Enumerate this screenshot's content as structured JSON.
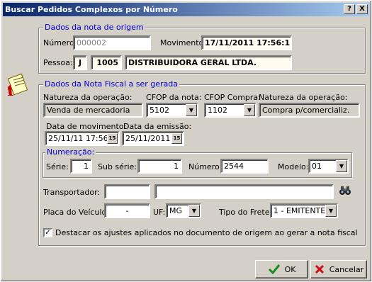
{
  "window": {
    "title": "Buscar Pedidos Complexos por Número",
    "help_label": "?",
    "close_label": "X"
  },
  "origem": {
    "legend": "Dados da nota de origem",
    "numero_label": "Número:",
    "numero_value": "000002",
    "movimento_label": "Movimento:",
    "movimento_value": "17/11/2011 17:56:12",
    "pessoa_label": "Pessoa:",
    "pessoa_tipo": "J",
    "pessoa_codigo": "1005",
    "pessoa_nome": "DISTRIBUIDORA GERAL LTDA."
  },
  "nota": {
    "legend": "Dados da Nota Fiscal a ser gerada",
    "natureza_label": "Natureza da operação:",
    "natureza_value": "Venda de mercadoria",
    "cfop_nota_label": "CFOP da nota:",
    "cfop_nota_value": "5102",
    "cfop_compra_label": "CFOP Compra:",
    "cfop_compra_value": "1102",
    "natureza2_label": "Natureza da operação:",
    "natureza2_value": "Compra p/comercializ.",
    "data_mov_label": "Data de movimento:",
    "data_mov_value": "25/11/11 17:56",
    "data_emis_label": "Data da emissão:",
    "data_emis_value": "25/11/2011",
    "cal_label": "15",
    "numeracao_legend": "Numeração:",
    "serie_label": "Série:",
    "serie_value": "1",
    "subserie_label": "Sub série:",
    "subserie_value": "1",
    "numero_label": "Número:",
    "numero_value": "2544",
    "modelo_label": "Modelo:",
    "modelo_value": "01",
    "transportador_label": "Transportador:",
    "transportador_codigo": "",
    "transportador_nome": "",
    "placa_label": "Placa do Veículo:",
    "placa_value": "-",
    "uf_label": "UF:",
    "uf_value": "MG",
    "frete_label": "Tipo do Frete:",
    "frete_value": "1 - EMITENTE",
    "destacar_label": "Destacar os ajustes aplicados no documento de origem ao gerar a nota fiscal",
    "destacar_checked": "✓"
  },
  "buttons": {
    "ok_label": "OK",
    "cancel_label": "Cancelar"
  },
  "colors": {
    "accent": "#0000cc",
    "title_bar": "#0a246a"
  },
  "icons": [
    "notepad-icon",
    "binoculars-icon",
    "check-icon",
    "cancel-x-icon",
    "calendar-icon",
    "chevron-down-icon"
  ]
}
